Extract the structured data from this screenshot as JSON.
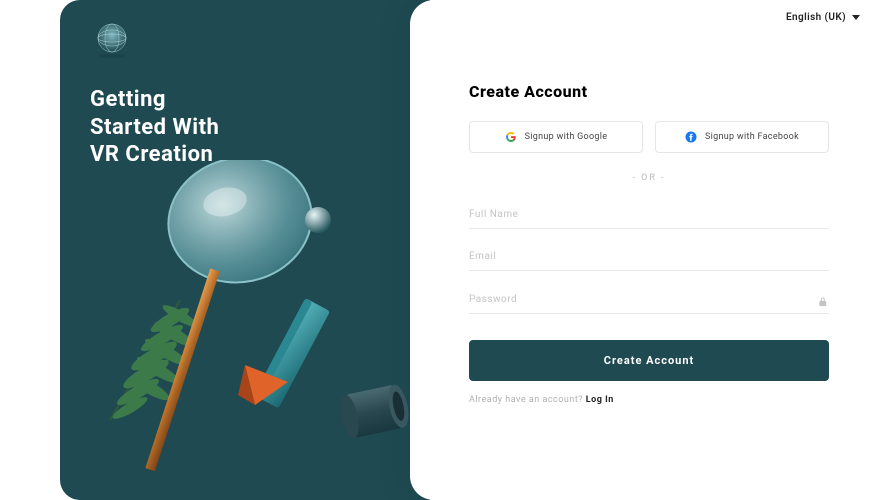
{
  "hero": {
    "heading_line1": "Getting",
    "heading_line2": "Started With",
    "heading_line3": "VR Creation"
  },
  "header": {
    "language_label": "English (UK)"
  },
  "form": {
    "title": "Create Account",
    "social": {
      "google_label": "Signup with Google",
      "facebook_label": "Signup with Facebook"
    },
    "divider": "- OR -",
    "fields": {
      "fullname_placeholder": "Full Name",
      "email_placeholder": "Email",
      "password_placeholder": "Password"
    },
    "submit_label": "Create Account",
    "login_prompt": "Already have an account? ",
    "login_link": "Log In"
  },
  "colors": {
    "brand_teal": "#1f4a52",
    "text_muted": "#b0b0b0"
  }
}
